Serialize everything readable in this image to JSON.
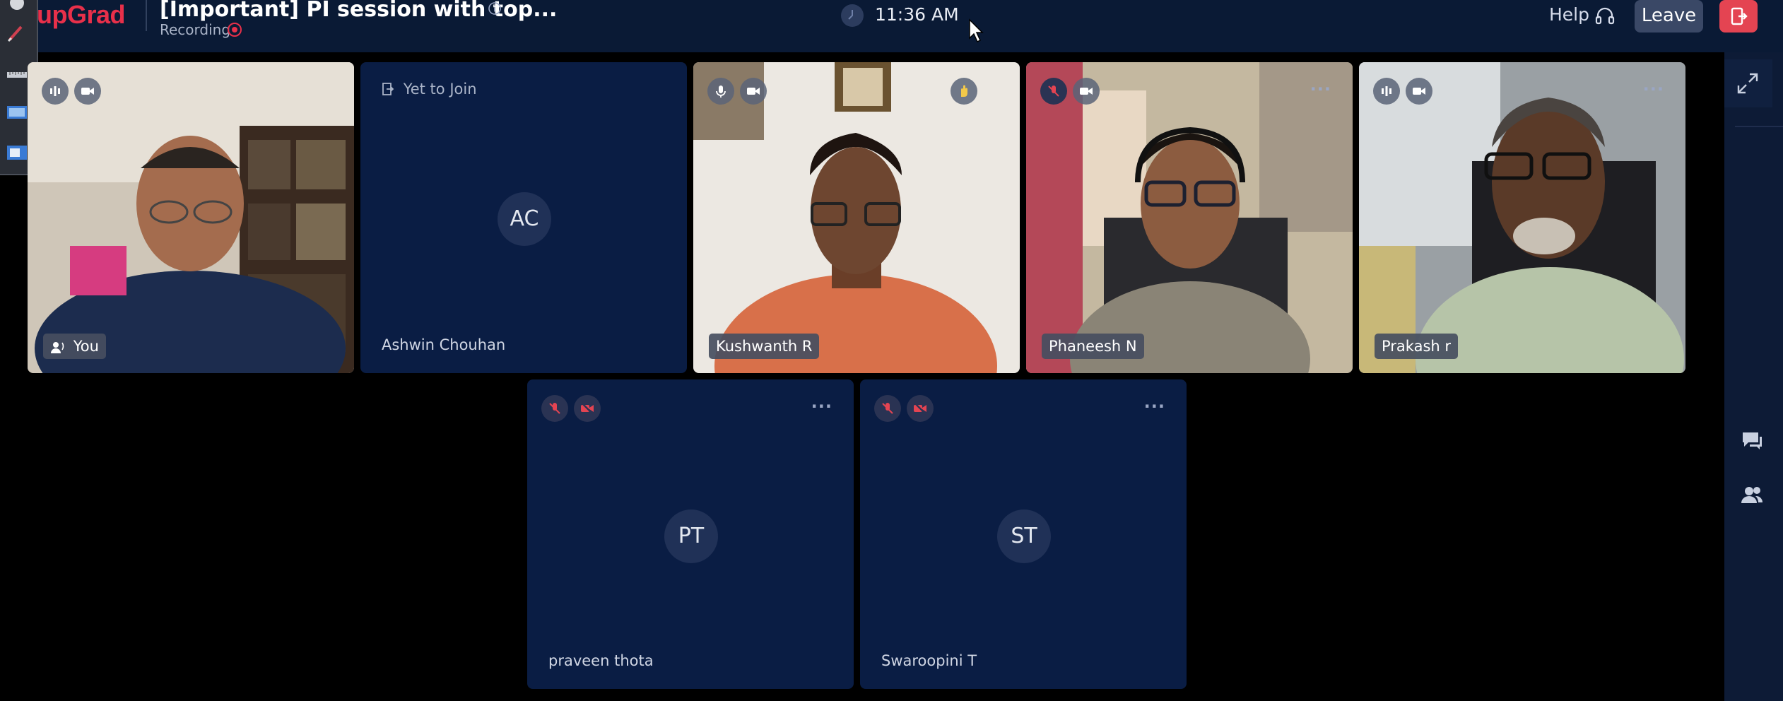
{
  "header": {
    "brand": "upGrad",
    "title": "[Important] PI session with top...",
    "recording_label": "Recording",
    "time": "11:36 AM",
    "help_label": "Help",
    "leave_label": "Leave"
  },
  "participants": [
    {
      "name": "You",
      "type": "video",
      "mic": "on",
      "cam": "on"
    },
    {
      "name": "Ashwin Chouhan",
      "type": "avatar",
      "initials": "AC",
      "status": "Yet to Join"
    },
    {
      "name": "Kushwanth R",
      "type": "video",
      "mic": "on",
      "cam": "on",
      "hand_raised": true
    },
    {
      "name": "Phaneesh N",
      "type": "video",
      "mic": "off",
      "cam": "on"
    },
    {
      "name": "Prakash r",
      "type": "video",
      "mic": "on",
      "cam": "on"
    },
    {
      "name": "praveen thota",
      "type": "avatar",
      "initials": "PT",
      "mic": "off",
      "cam": "off"
    },
    {
      "name": "Swaroopini T",
      "type": "avatar",
      "initials": "ST",
      "mic": "off",
      "cam": "off"
    }
  ],
  "icons": {
    "brand_color": "#e8304a",
    "accent": "#e44452",
    "tile_bg": "#0a1d44",
    "header_bg": "#0a1a35"
  }
}
